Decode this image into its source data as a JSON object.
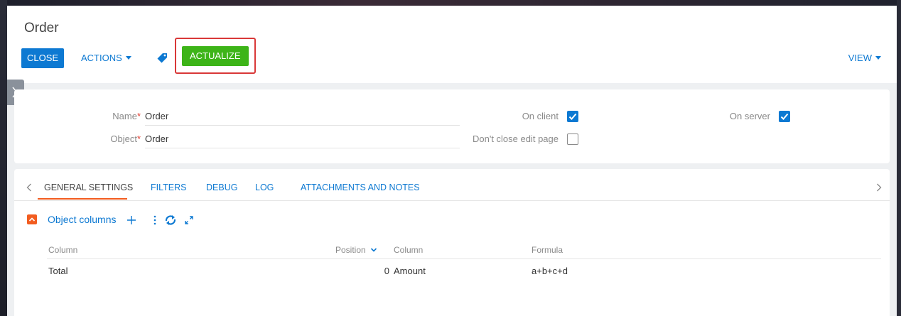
{
  "page": {
    "title": "Order"
  },
  "toolbar": {
    "close_label": "CLOSE",
    "actions_label": "ACTIONS",
    "actualize_label": "ACTUALIZE",
    "view_label": "VIEW",
    "tag_icon": "tag-icon"
  },
  "fields": {
    "name_label": "Name",
    "name_value": "Order",
    "object_label": "Object",
    "object_value": "Order",
    "required_mark": "*",
    "on_client_label": "On client",
    "on_client_checked": true,
    "dont_close_label": "Don't close edit page",
    "dont_close_checked": false,
    "on_server_label": "On server",
    "on_server_checked": true
  },
  "tabs": [
    {
      "label": "GENERAL SETTINGS",
      "active": true
    },
    {
      "label": "FILTERS",
      "active": false
    },
    {
      "label": "DEBUG",
      "active": false
    },
    {
      "label": "LOG",
      "active": false
    },
    {
      "label": "ATTACHMENTS AND NOTES",
      "active": false
    }
  ],
  "detail": {
    "title": "Object columns",
    "tools": [
      "add-icon",
      "more-icon",
      "refresh-icon",
      "expand-icon"
    ],
    "columns": [
      "Column",
      "Position",
      "Column",
      "Formula"
    ],
    "rows": [
      {
        "column": "Total",
        "position": "0",
        "target_column": "Amount",
        "formula": "a+b+c+d"
      }
    ]
  },
  "colors": {
    "primary": "#0d79d2",
    "success": "#3db418",
    "accent": "#f25c1f",
    "highlight": "#d93838"
  }
}
